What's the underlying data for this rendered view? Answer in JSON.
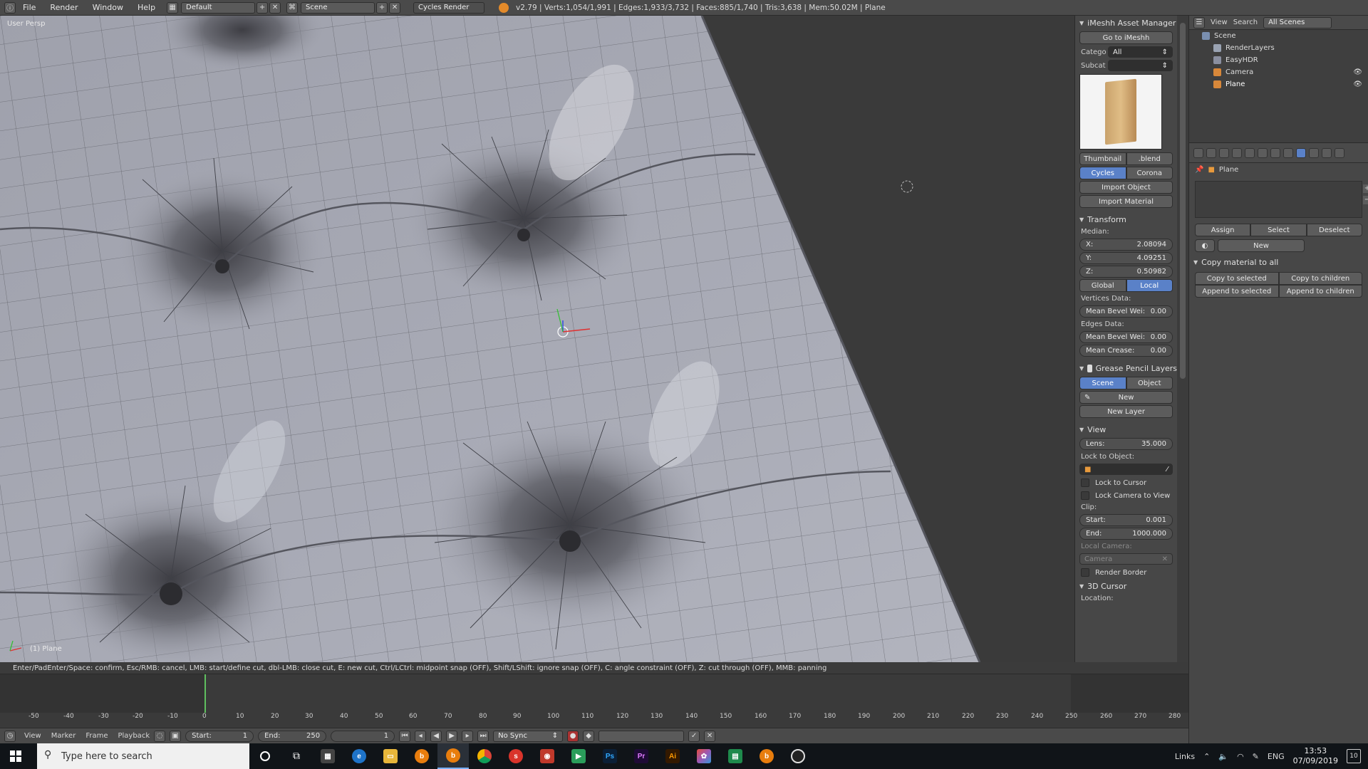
{
  "topbar": {
    "menus": [
      "File",
      "Render",
      "Window",
      "Help"
    ],
    "layout": "Default",
    "scene": "Scene",
    "engine": "Cycles Render",
    "stats": "v2.79 | Verts:1,054/1,991 | Edges:1,933/3,732 | Faces:885/1,740 | Tris:3,638 | Mem:50.02M | Plane"
  },
  "viewport": {
    "view_label": "User Persp",
    "object_label": "(1) Plane"
  },
  "npanel": {
    "imeshh_title": "iMeshh Asset Manager",
    "go_to": "Go to iMeshh",
    "catego_label": "Catego",
    "catego_value": "All",
    "subcat_label": "Subcat",
    "subcat_value": "",
    "thumbnail_btn": "Thumbnail",
    "blend_btn": ".blend",
    "engine_tabs": [
      "Cycles",
      "Corona"
    ],
    "import_object": "Import Object",
    "import_material": "Import Material",
    "transform_title": "Transform",
    "median_label": "Median:",
    "x": {
      "label": "X:",
      "value": "2.08094"
    },
    "y": {
      "label": "Y:",
      "value": "4.09251"
    },
    "z": {
      "label": "Z:",
      "value": "0.50982"
    },
    "space_tabs": [
      "Global",
      "Local"
    ],
    "vertices_data": "Vertices Data:",
    "mean_bevel_v": {
      "label": "Mean Bevel Wei:",
      "value": "0.00"
    },
    "edges_data": "Edges Data:",
    "mean_bevel_e": {
      "label": "Mean Bevel Wei:",
      "value": "0.00"
    },
    "mean_crease": {
      "label": "Mean Crease:",
      "value": "0.00"
    },
    "grease_title": "Grease Pencil Layers",
    "grease_tabs": [
      "Scene",
      "Object"
    ],
    "new_btn": "New",
    "new_layer": "New Layer",
    "view_title": "View",
    "lens": {
      "label": "Lens:",
      "value": "35.000"
    },
    "lock_to_object": "Lock to Object:",
    "lock_to_cursor": "Lock to Cursor",
    "lock_camera": "Lock Camera to View",
    "clip_label": "Clip:",
    "clip_start": {
      "label": "Start:",
      "value": "0.001"
    },
    "clip_end": {
      "label": "End:",
      "value": "1000.000"
    },
    "local_camera": "Local Camera:",
    "camera_field": "Camera",
    "render_border": "Render Border",
    "cursor_title": "3D Cursor",
    "location_label": "Location:"
  },
  "outliner": {
    "view": "View",
    "search": "Search",
    "filter": "All Scenes",
    "items": [
      "Scene",
      "RenderLayers",
      "EasyHDR",
      "Camera",
      "Plane"
    ]
  },
  "properties": {
    "object": "Plane",
    "assign": "Assign",
    "select": "Select",
    "deselect": "Deselect",
    "new": "New",
    "copy_title": "Copy material to all",
    "copy_selected": "Copy to selected",
    "copy_children": "Copy to children",
    "append_selected": "Append to selected",
    "append_children": "Append to children"
  },
  "status": {
    "hint": "Enter/PadEnter/Space: confirm, Esc/RMB: cancel, LMB: start/define cut, dbl-LMB: close cut, E: new cut, Ctrl/LCtrl: midpoint snap (OFF), Shift/LShift: ignore snap (OFF), C: angle constraint (OFF), Z: cut through (OFF), MMB: panning"
  },
  "timeline": {
    "ruler": [
      "-50",
      "-40",
      "-30",
      "-20",
      "-10",
      "0",
      "10",
      "20",
      "30",
      "40",
      "50",
      "60",
      "70",
      "80",
      "90",
      "100",
      "110",
      "120",
      "130",
      "140",
      "150",
      "160",
      "170",
      "180",
      "190",
      "200",
      "210",
      "220",
      "230",
      "240",
      "250",
      "260",
      "270",
      "280"
    ],
    "menus": [
      "View",
      "Marker",
      "Frame",
      "Playback"
    ],
    "start": {
      "label": "Start:",
      "value": "1"
    },
    "end": {
      "label": "End:",
      "value": "250"
    },
    "current": "1",
    "sync": "No Sync"
  },
  "taskbar": {
    "search_placeholder": "Type here to search",
    "links": "Links",
    "lang": "ENG",
    "time": "13:53",
    "date": "07/09/2019",
    "notif": "10"
  },
  "colors": {
    "accent": "#5a81c8",
    "mesh": "#a7a9b4",
    "background": "#3d3d3d"
  }
}
